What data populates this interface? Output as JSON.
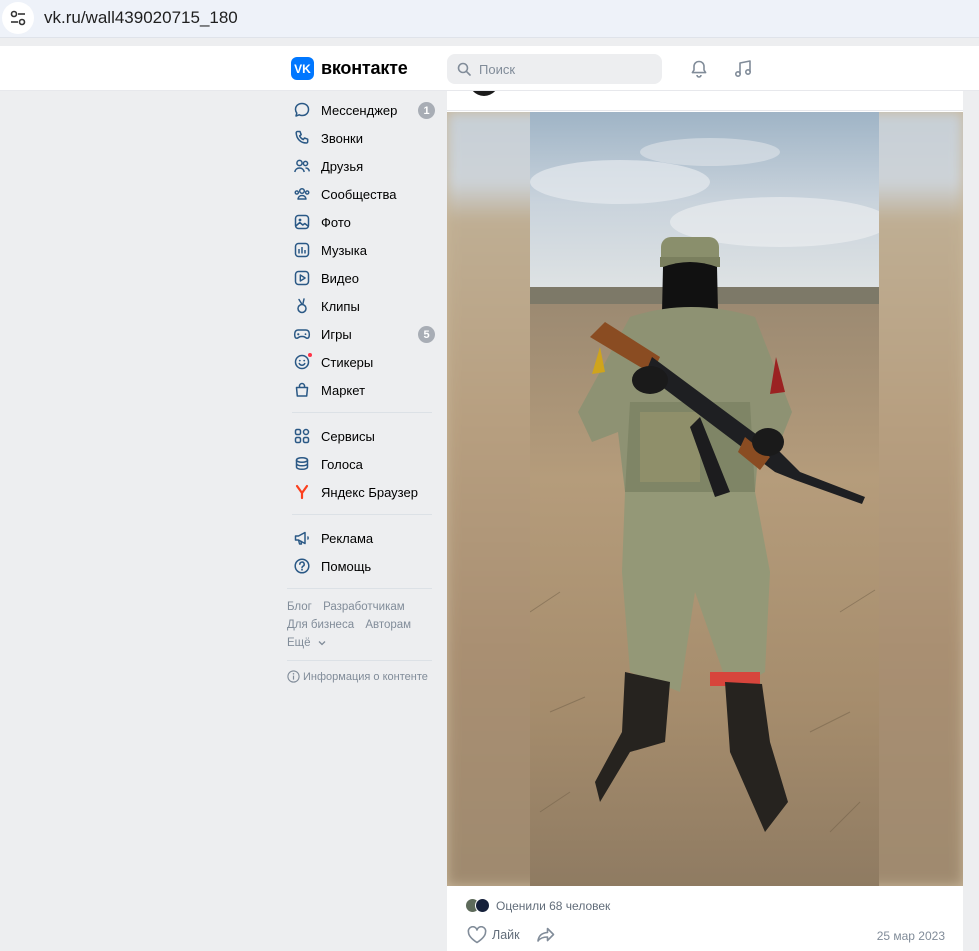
{
  "browser": {
    "url": "vk.ru/wall439020715_180"
  },
  "header": {
    "logo_mark": "VK",
    "logo_text": "вконтакте",
    "search_placeholder": "Поиск"
  },
  "menu": {
    "group1": [
      {
        "label": "Мессенджер",
        "icon": "chat-bubble-icon",
        "badge": "1"
      },
      {
        "label": "Звонки",
        "icon": "phone-icon"
      },
      {
        "label": "Друзья",
        "icon": "friends-icon"
      },
      {
        "label": "Сообщества",
        "icon": "communities-icon"
      },
      {
        "label": "Фото",
        "icon": "photo-icon"
      },
      {
        "label": "Музыка",
        "icon": "music-icon"
      },
      {
        "label": "Видео",
        "icon": "video-icon"
      },
      {
        "label": "Клипы",
        "icon": "clips-icon"
      },
      {
        "label": "Игры",
        "icon": "gamepad-icon",
        "badge": "5"
      },
      {
        "label": "Стикеры",
        "icon": "sticker-icon"
      },
      {
        "label": "Маркет",
        "icon": "bag-icon"
      }
    ],
    "group2": [
      {
        "label": "Сервисы",
        "icon": "services-icon"
      },
      {
        "label": "Голоса",
        "icon": "coins-icon"
      },
      {
        "label": "Яндекс Браузер",
        "icon": "yandex-icon"
      }
    ],
    "group3": [
      {
        "label": "Реклама",
        "icon": "megaphone-icon"
      },
      {
        "label": "Помощь",
        "icon": "help-icon"
      }
    ],
    "footer": {
      "blog": "Блог",
      "developers": "Разработчикам",
      "business": "Для бизнеса",
      "authors": "Авторам",
      "more": "Ещё",
      "content_info": "Информация о контенте"
    }
  },
  "post": {
    "likes_text": "Оценили 68 человек",
    "like_label": "Лайк",
    "date": "25 мар 2023"
  },
  "colors": {
    "accent": "#0077ff",
    "badge": "#a8adb5",
    "text_secondary": "#818c99"
  }
}
